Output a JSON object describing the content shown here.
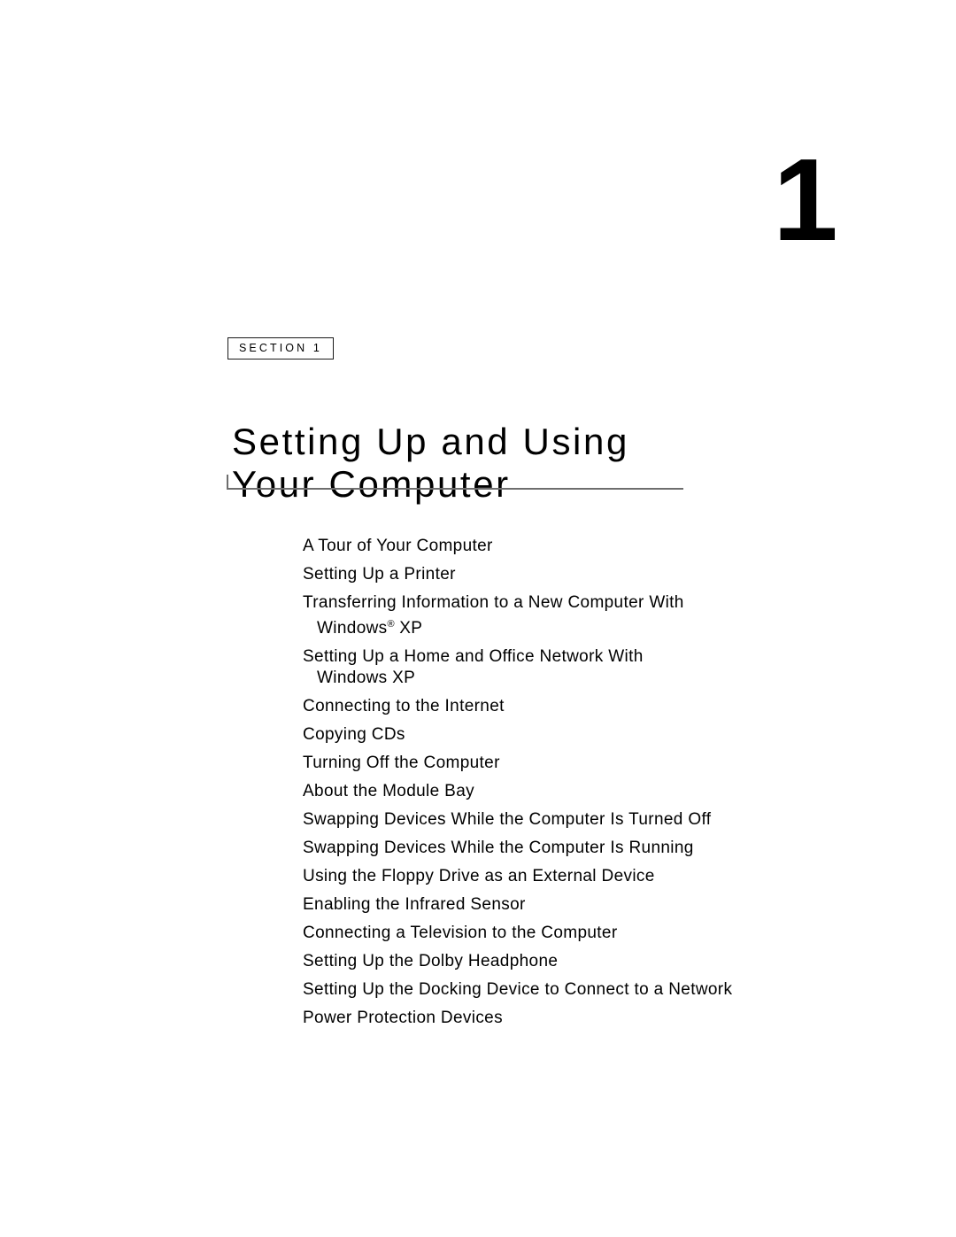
{
  "page": {
    "chapter_number": "1",
    "section_label": "SECTION 1",
    "title": "Setting Up and Using\nYour Computer"
  },
  "contents": {
    "items": [
      {
        "text": "A Tour of Your Computer"
      },
      {
        "text": "Setting Up a Printer"
      },
      {
        "text": "Transferring Information to a New Computer With",
        "continuation_prefix": "Windows",
        "continuation_mark": "®",
        "continuation_suffix": " XP"
      },
      {
        "text": "Setting Up a Home and Office Network With",
        "continuation": "Windows XP"
      },
      {
        "text": "Connecting to the Internet"
      },
      {
        "text": "Copying CDs"
      },
      {
        "text": "Turning Off the Computer"
      },
      {
        "text": "About the Module Bay"
      },
      {
        "text": "Swapping Devices While the Computer Is Turned Off"
      },
      {
        "text": "Swapping Devices While the Computer Is Running"
      },
      {
        "text": "Using the Floppy Drive as an External Device"
      },
      {
        "text": "Enabling the Infrared Sensor"
      },
      {
        "text": "Connecting a Television to the Computer"
      },
      {
        "text": "Setting Up the Dolby Headphone"
      },
      {
        "text": "Setting Up the Docking Device to Connect to a Network"
      },
      {
        "text": "Power Protection Devices"
      }
    ]
  },
  "colors": {
    "text": "#000000",
    "rule": "#6e6e6e",
    "background": "#ffffff",
    "badge_border": "#1a1a1a"
  }
}
